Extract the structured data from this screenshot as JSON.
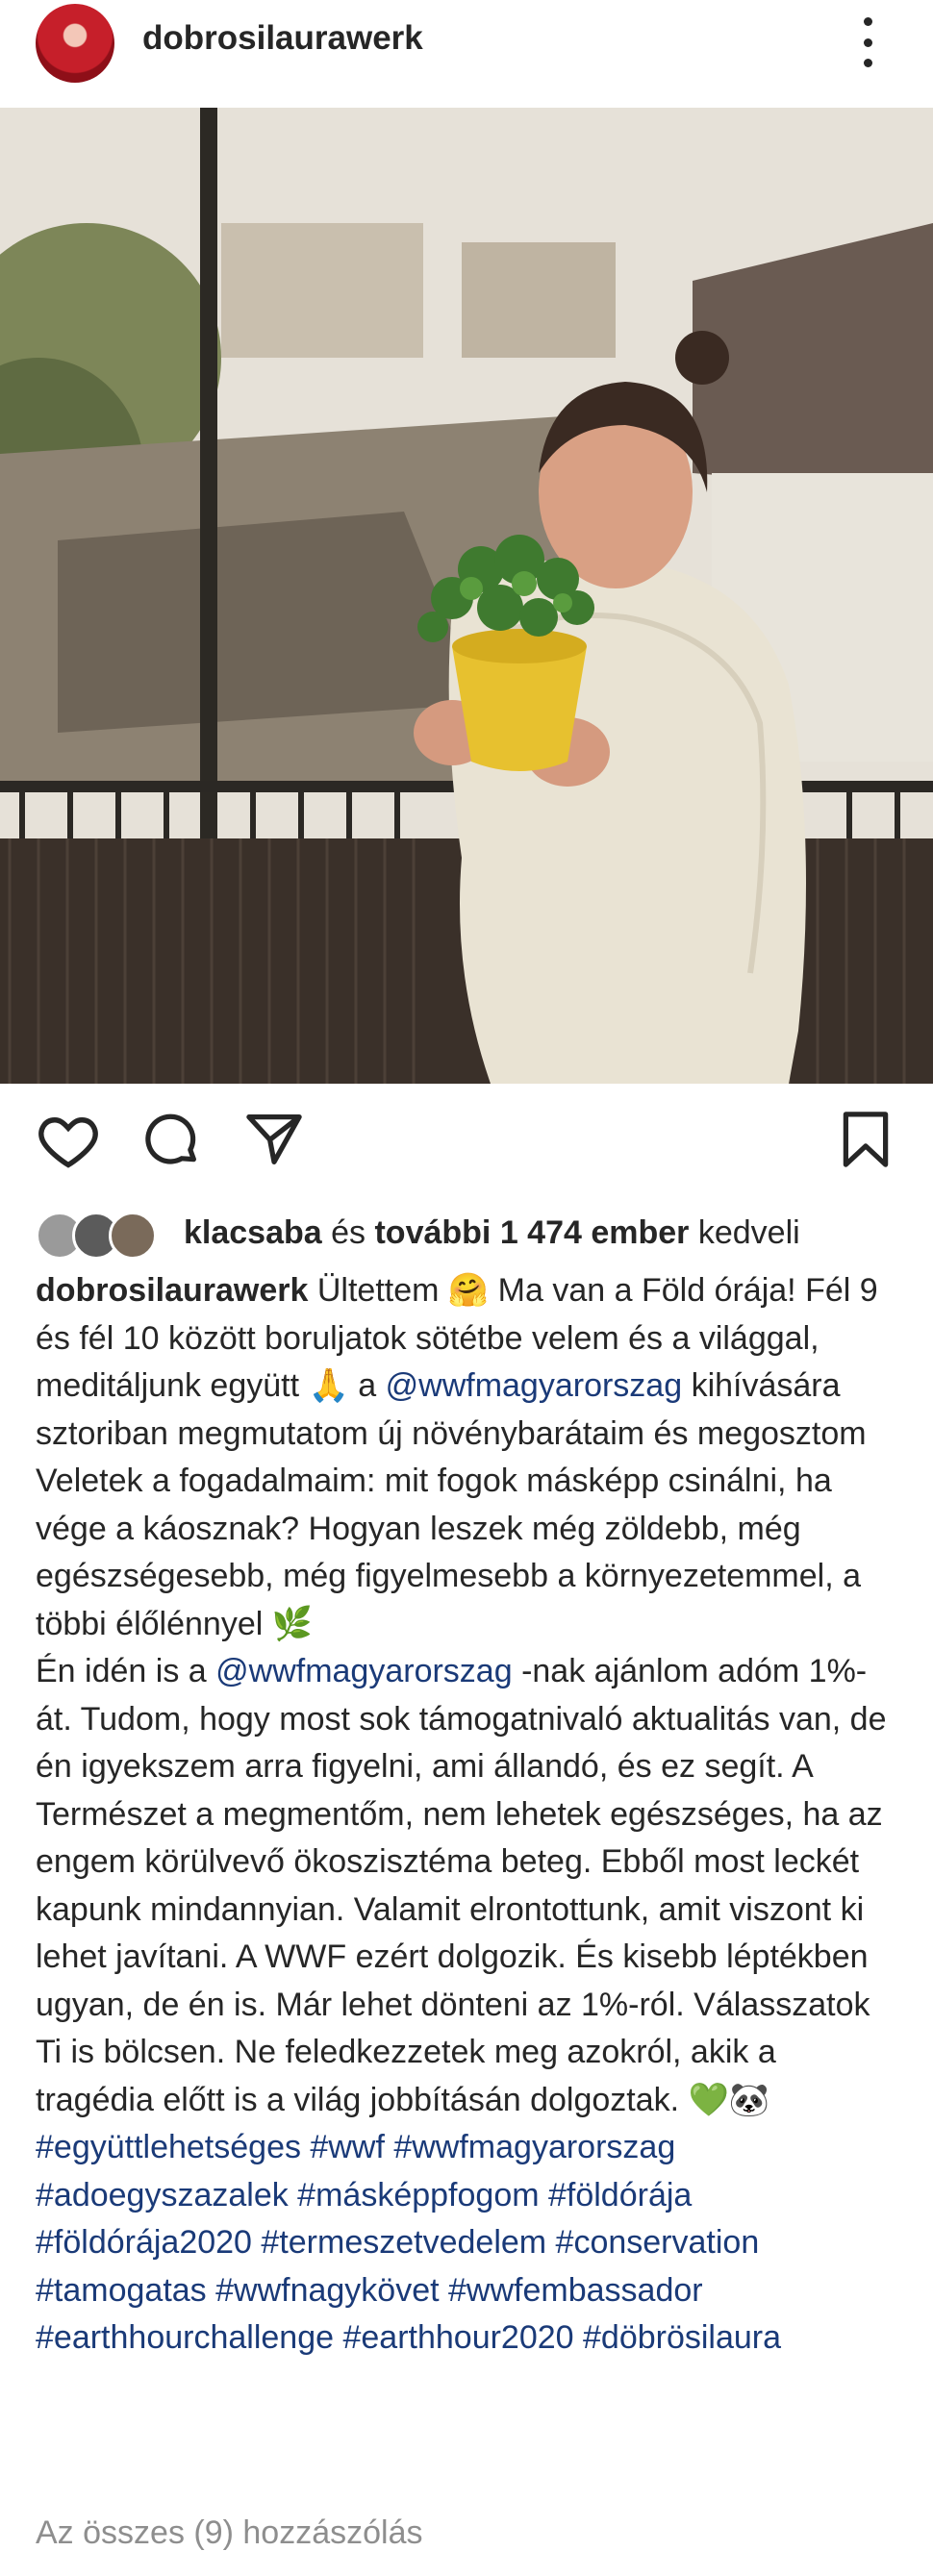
{
  "post": {
    "username": "dobrosilaurawerk"
  },
  "likes": {
    "first_liker": "klacsaba",
    "connector": " és ",
    "others": "további 1 474 ember",
    "suffix": " kedveli"
  },
  "caption": {
    "username": "dobrosilaurawerk",
    "part1": " Ültettem 🤗 Ma van a Föld órája! Fél 9 és fél 10 között boruljatok sötétbe velem és a világgal, meditáljunk együtt 🙏 a ",
    "mention1": "@wwfmagyarorszag",
    "part2": " kihívására sztoriban megmutatom új növénybarátaim és megosztom Veletek a fogadalmaim: mit fogok másképp csinálni, ha vége a káosznak? Hogyan leszek még zöldebb, még egészségesebb, még figyelmesebb a környezetemmel, a többi élőlénnyel 🌿",
    "part3": "Én idén is a ",
    "mention2": "@wwfmagyarorszag",
    "part4": " -nak ajánlom adóm 1%-át. Tudom, hogy most sok támogatnivaló aktualitás van, de én igyekszem arra figyelni, ami állandó, és ez segít. A Természet a megmentőm, nem lehetek egészséges, ha az engem körülvevő ökoszisztéma beteg. Ebből most leckét kapunk mindannyian. Valamit elrontottunk, amit viszont ki lehet javítani. A WWF ezért dolgozik. És  kisebb léptékben ugyan, de én is. Már lehet dönteni az 1%-ról. Válasszatok Ti is bölcsen. Ne feledkezzetek meg azokról, akik a tragédia előtt is a világ jobbításán dolgoztak. 💚🐼",
    "hashtags": "#együttlehetséges #wwf #wwfmagyarorszag #adoegyszazalek #másképpfogom #földórája #földórája2020 #termeszetvedelem #conservation #tamogatas #wwfnagykövet #wwfembassador #earthhourchallenge #earthhour2020 #döbrösilaura"
  },
  "comments": {
    "view_all": "Az összes (9) hozzászólás"
  },
  "icons": {
    "like": "heart-icon",
    "comment": "comment-icon",
    "share": "send-icon",
    "save": "bookmark-icon",
    "more": "more-vertical-icon"
  },
  "colors": {
    "text": "#262626",
    "link": "#1a3a78",
    "muted": "#8e8e8e"
  }
}
